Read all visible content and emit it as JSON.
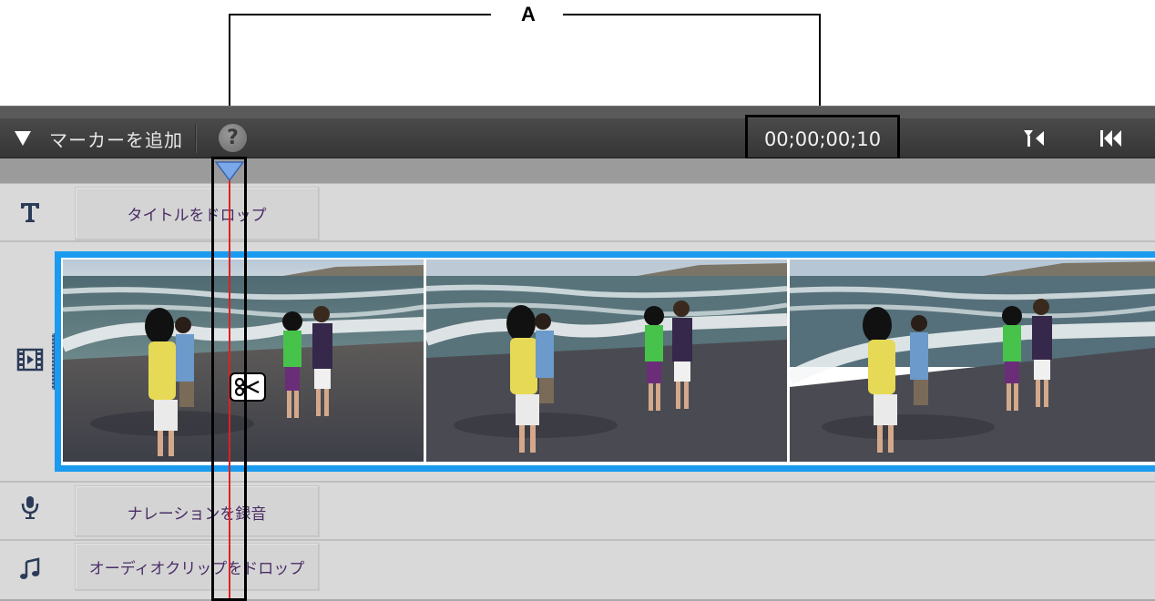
{
  "callout": {
    "label": "A"
  },
  "toolbar": {
    "add_marker_label": "マーカーを追加",
    "help_icon": "question-mark-icon",
    "timecode": "00;00;00;10",
    "buttons": [
      {
        "icon": "trim-to-playhead-icon"
      },
      {
        "icon": "go-to-start-icon"
      }
    ]
  },
  "tracks": {
    "title": {
      "icon": "title-T-icon",
      "drop_label": "タイトルをドロップ"
    },
    "video": {
      "icon": "film-icon"
    },
    "narration": {
      "icon": "microphone-icon",
      "drop_label": "ナレーションを録音"
    },
    "audio": {
      "icon": "music-note-icon",
      "drop_label": "オーディオクリップをドロップ"
    }
  },
  "playhead": {
    "icon": "scissors-icon"
  },
  "colors": {
    "clip_border": "#1b9bf0",
    "playhead": "#e02020",
    "drop_text": "#4a2d66",
    "toolbar_bg": "#3f3f3f"
  }
}
